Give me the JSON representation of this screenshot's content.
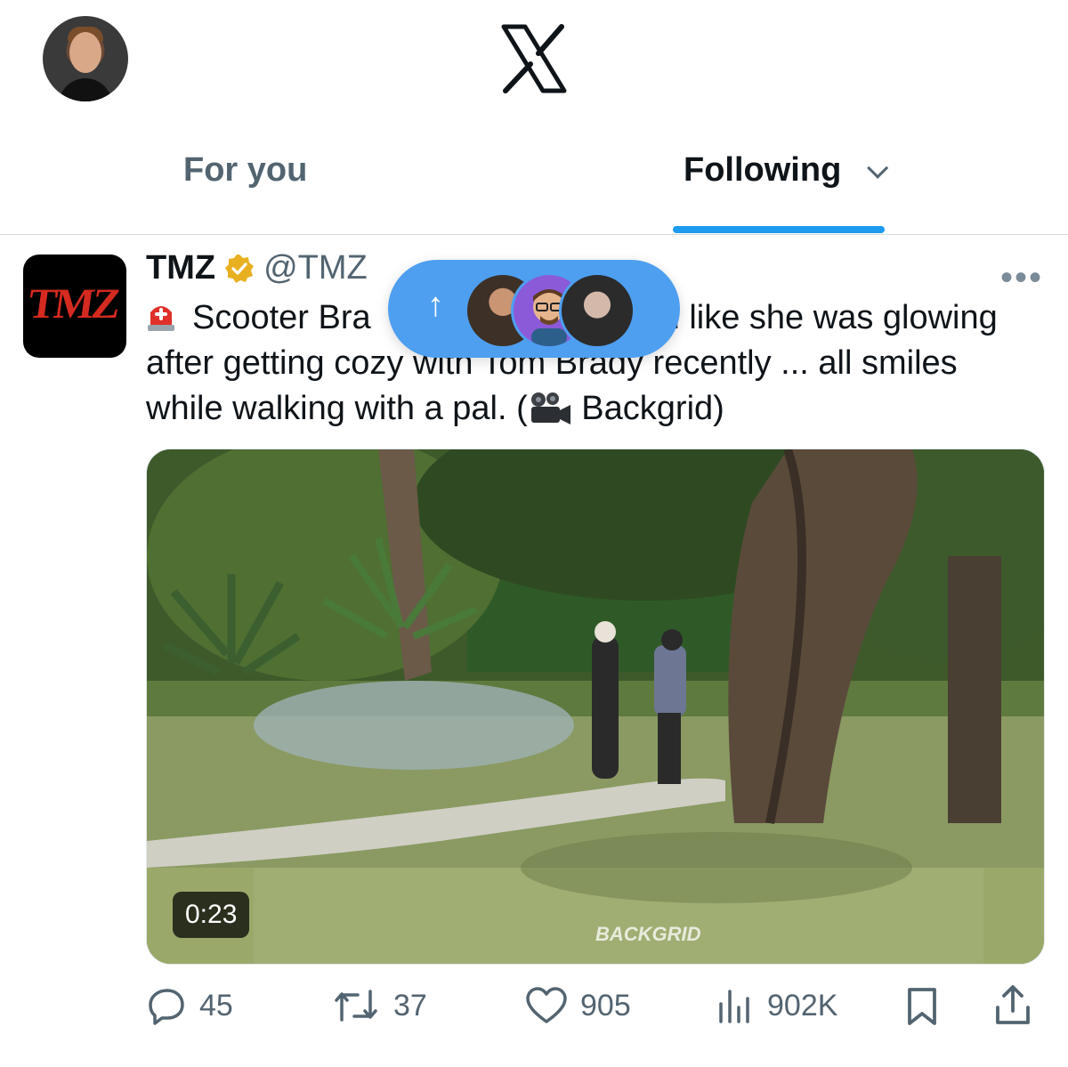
{
  "header": {
    "profile_avatar": "user-avatar",
    "logo": "x-logo"
  },
  "tabs": [
    {
      "label": "For you",
      "active": false
    },
    {
      "label": "Following",
      "active": true,
      "icon": "chevron-down-icon"
    }
  ],
  "accent_color": "#1d9bf0",
  "new_posts_pill": {
    "icon": "arrow-up-icon",
    "avatars": [
      "avatar-1",
      "avatar-2",
      "avatar-3"
    ],
    "color": "#4e9ff0"
  },
  "tweet": {
    "avatar_text": "TMZ",
    "display_name": "TMZ",
    "verified_badge": "gold-verified-icon",
    "handle": "@TMZ",
    "more_icon": "more-dots-icon",
    "text_line1_pre": "Scooter Bra",
    "text_line1_post": "d like she was glowing",
    "text_line2_pre": "after getting cozy ",
    "text_line2_occluded": "with Tom Brady",
    "text_line2_post": " recently ... all smiles",
    "text_line3_pre": "while walking with a pal. (",
    "text_line3_post": " Backgrid)",
    "media": {
      "watermark": "BACKGRID",
      "duration": "0:23"
    },
    "actions": {
      "replies": "45",
      "reposts": "37",
      "likes": "905",
      "views": "902K"
    }
  }
}
